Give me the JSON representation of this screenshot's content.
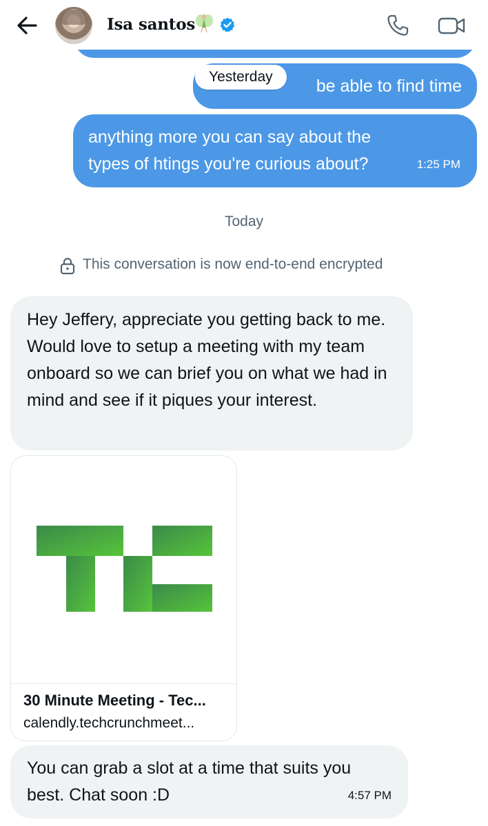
{
  "header": {
    "name": "Isa santos",
    "fairy_icon": "fairy-emoji",
    "verified_icon": "verified-badge-icon",
    "back_icon": "back-arrow-icon",
    "call_icon": "phone-icon",
    "video_icon": "video-camera-icon"
  },
  "colors": {
    "sent_bubble": "#4c98e6",
    "received_bubble": "#eff3f4",
    "verified": "#1d9bf0",
    "secondary_text": "#536471",
    "tc_logo_green": "#4fbf3c"
  },
  "messages": {
    "sent_partial_text": "be able to find time",
    "yesterday_label": "Yesterday",
    "sent_question": "anything more you can say about the types of htings you're curious about?",
    "sent_question_time": "1:25 PM",
    "today_label": "Today",
    "encryption_notice": "This conversation is now end-to-end encrypted",
    "received_1": "Hey Jeffery, appreciate you getting back to me. Would love to setup a meeting with my team onboard so we can brief you on what we had in mind and see if it piques your interest.",
    "link_card": {
      "title": "30 Minute Meeting - Tec...",
      "url": "calendly.techcrunchmeet...",
      "logo": "techcrunch-logo"
    },
    "received_2": "You can grab a slot at a time that suits you best. Chat soon :D",
    "received_2_time": "4:57 PM"
  }
}
